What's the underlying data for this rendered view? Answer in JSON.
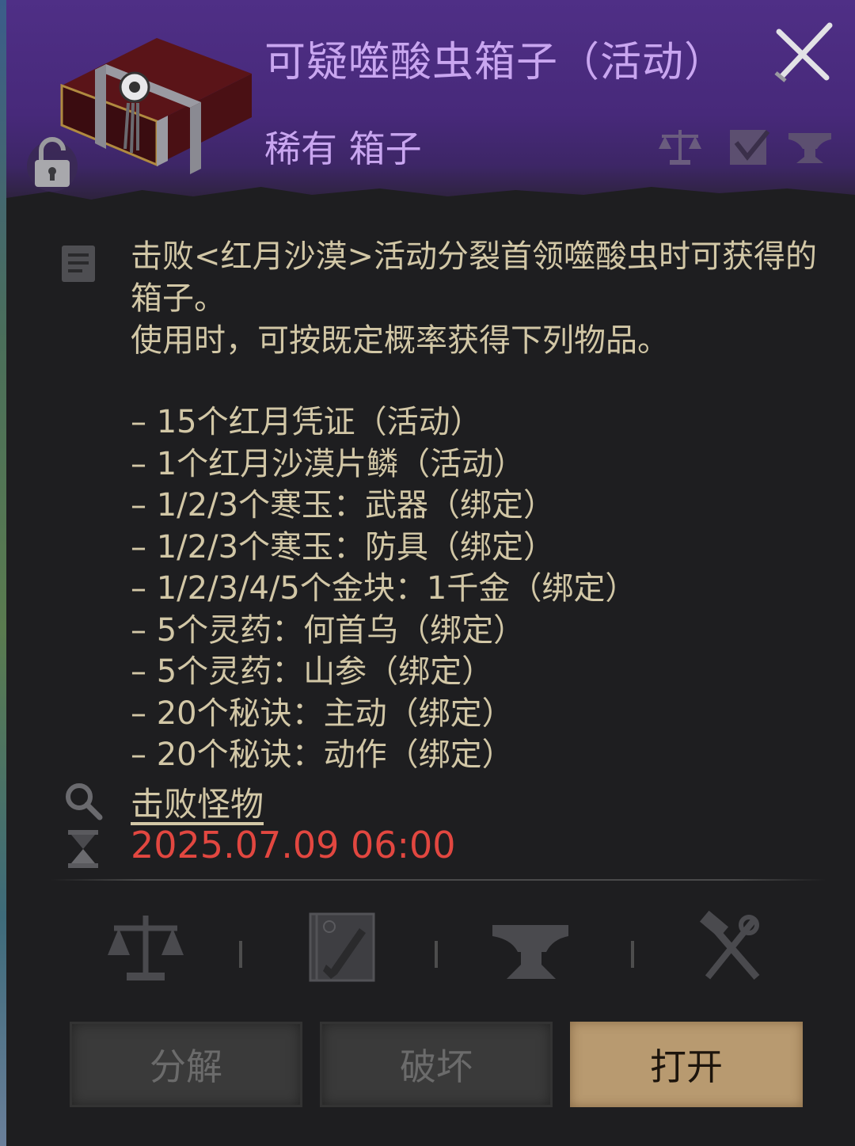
{
  "item": {
    "name": "可疑噬酸虫箱子（活动）",
    "grade_type": "稀有 箱子"
  },
  "header_icons": [
    "scale-icon",
    "checkmark-box-icon",
    "anvil-icon"
  ],
  "description": {
    "text": "击败<红月沙漠>活动分裂首领噬酸虫时可获得的箱子。\n使用时，可按既定概率获得下列物品。",
    "rewards": [
      "– 15个红月凭证（活动）",
      "– 1个红月沙漠片鳞（活动）",
      "– 1/2/3个寒玉：武器（绑定）",
      "– 1/2/3个寒玉：防具（绑定）",
      "– 1/2/3/4/5个金块：1千金（绑定）",
      "– 5个灵药：何首乌（绑定）",
      "– 5个灵药：山参（绑定）",
      "– 20个秘诀：主动（绑定）",
      "– 20个秘诀：动作（绑定）"
    ]
  },
  "source": {
    "label": "击败怪物"
  },
  "expiry": {
    "datetime": "2025.07.09 06:00"
  },
  "action_icons": [
    "scale-icon",
    "skill-book-icon",
    "anvil-icon",
    "hammer-tongs-icon"
  ],
  "buttons": {
    "decompose": "分解",
    "destroy": "破坏",
    "open": "打开"
  },
  "colors": {
    "header_bg": "#4f2f86",
    "title": "#c9a6f0",
    "text": "#d2c7a6",
    "expiry": "#e24740",
    "primary_button": "#b89a70"
  }
}
